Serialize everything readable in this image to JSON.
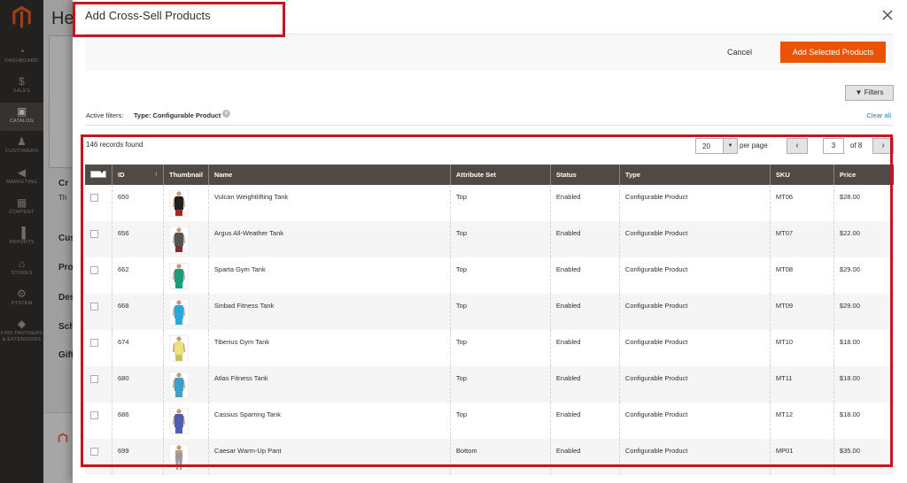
{
  "sidebar": {
    "items": [
      {
        "label": "DASHBOARD",
        "icon": "speedometer-icon"
      },
      {
        "label": "SALES",
        "icon": "dollar-icon"
      },
      {
        "label": "CATALOG",
        "icon": "box-icon"
      },
      {
        "label": "CUSTOMERS",
        "icon": "person-icon"
      },
      {
        "label": "MARKETING",
        "icon": "megaphone-icon"
      },
      {
        "label": "CONTENT",
        "icon": "layout-icon"
      },
      {
        "label": "REPORTS",
        "icon": "bar-chart-icon"
      },
      {
        "label": "STORES",
        "icon": "store-icon"
      },
      {
        "label": "SYSTEM",
        "icon": "gear-icon"
      },
      {
        "label": "FIND PARTNERS & EXTENSIONS",
        "icon": "cube-icon"
      }
    ]
  },
  "background": {
    "title": "He",
    "links": [
      "Cr",
      "Th",
      "Cus",
      "Pro",
      "Des",
      "Sch",
      "Gift"
    ]
  },
  "modal": {
    "title": "Add Cross-Sell Products",
    "cancel_label": "Cancel",
    "add_label": "Add Selected Products",
    "filters_label": "Filters",
    "active_filters_label": "Active filters:",
    "active_filter_value": "Type: Configurable Product",
    "clear_all_label": "Clear all",
    "records_found": "146 records found",
    "per_page_value": "20",
    "per_page_label": "per page",
    "page_current": "3",
    "page_of": "of 8"
  },
  "grid": {
    "columns": [
      "ID",
      "Thumbnail",
      "Name",
      "Attribute Set",
      "Status",
      "Type",
      "SKU",
      "Price"
    ],
    "rows": [
      {
        "id": "650",
        "name": "Vulcan Weightlifting Tank",
        "attribute_set": "Top",
        "status": "Enabled",
        "type": "Configurable Product",
        "sku": "MT06",
        "price": "$28.00",
        "shirt": "#1f1f1f",
        "trim": "#b22222"
      },
      {
        "id": "656",
        "name": "Argus All-Weather Tank",
        "attribute_set": "Top",
        "status": "Enabled",
        "type": "Configurable Product",
        "sku": "MT07",
        "price": "$22.00",
        "shirt": "#555555",
        "trim": "#7a3030"
      },
      {
        "id": "662",
        "name": "Sparta Gym Tank",
        "attribute_set": "Top",
        "status": "Enabled",
        "type": "Configurable Product",
        "sku": "MT08",
        "price": "$29.00",
        "shirt": "#1a9b7a",
        "trim": "#1a9b7a"
      },
      {
        "id": "668",
        "name": "Sinbad Fitness Tank",
        "attribute_set": "Top",
        "status": "Enabled",
        "type": "Configurable Product",
        "sku": "MT09",
        "price": "$29.00",
        "shirt": "#2aa9d8",
        "trim": "#2aa9d8"
      },
      {
        "id": "674",
        "name": "Tiberius Gym Tank",
        "attribute_set": "Top",
        "status": "Enabled",
        "type": "Configurable Product",
        "sku": "MT10",
        "price": "$18.00",
        "shirt": "#e6e47a",
        "trim": "#c9c060"
      },
      {
        "id": "680",
        "name": "Atlas Fitness Tank",
        "attribute_set": "Top",
        "status": "Enabled",
        "type": "Configurable Product",
        "sku": "MT11",
        "price": "$18.00",
        "shirt": "#37a3c9",
        "trim": "#37a3c9"
      },
      {
        "id": "686",
        "name": "Cassius Sparring Tank",
        "attribute_set": "Top",
        "status": "Enabled",
        "type": "Configurable Product",
        "sku": "MT12",
        "price": "$18.00",
        "shirt": "#4d5fb0",
        "trim": "#4d5fb0"
      },
      {
        "id": "699",
        "name": "Caesar Warm-Up Pant",
        "attribute_set": "Bottom",
        "status": "Enabled",
        "type": "Configurable Product",
        "sku": "MP01",
        "price": "$35.00",
        "shirt": "#9a9a9a",
        "trim": "#7a7a7a"
      }
    ]
  },
  "colors": {
    "accent": "#eb5202",
    "header_bg": "#514943",
    "sidebar_bg": "#373330",
    "annotation": "#c4161c"
  }
}
